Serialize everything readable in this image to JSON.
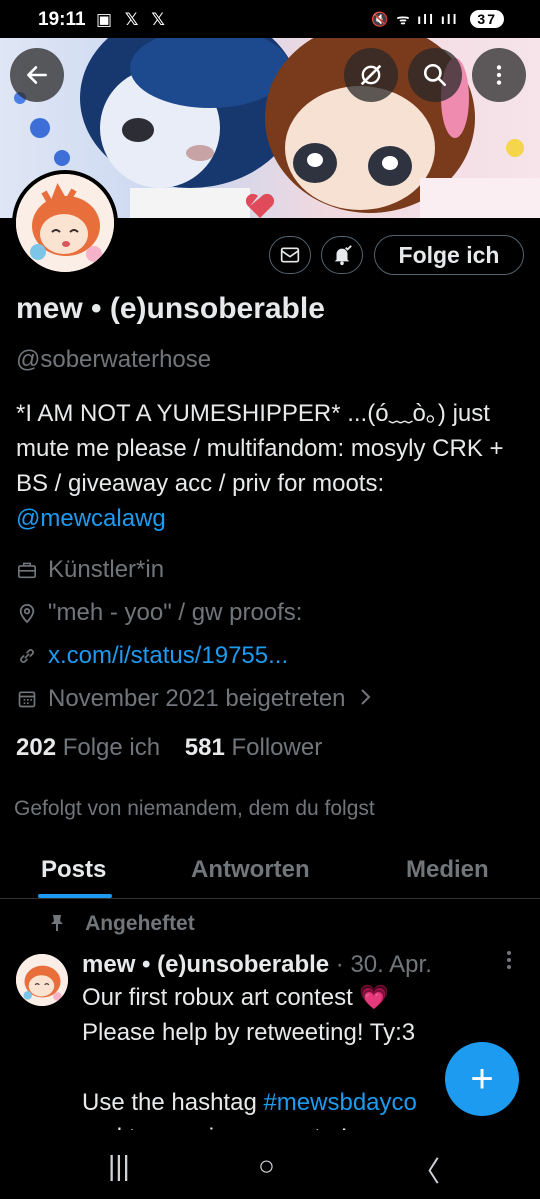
{
  "status_bar": {
    "time": "19:11",
    "left_icons": "▣ 𝕏 𝕏",
    "right_icons": "🔇 ᯤ ıll ıll",
    "battery": "37"
  },
  "header": {
    "back_icon": "arrow-left-icon",
    "mute_icon": "mute-icon",
    "search_icon": "search-icon",
    "more_icon": "more-vertical-icon"
  },
  "actions": {
    "message_icon": "mail-icon",
    "notify_icon": "bell-check-icon",
    "follow_label": "Folge ich"
  },
  "profile": {
    "name": "mew • (e)unsoberable",
    "handle": "@soberwaterhose",
    "bio_text": "*I AM NOT A YUMESHIPPER* ...(ó﹏ò｡) just mute me please / multifandom: mosyly CRK + BS  / giveaway acc / priv for moots: ",
    "bio_link": "@mewcalawg",
    "profession": "Künstler*in",
    "location": "\"meh - yoo\" / gw proofs:",
    "website": "x.com/i/status/19755...",
    "joined": "November 2021 beigetreten",
    "following_count": "202",
    "following_label": "Folge ich",
    "followers_count": "581",
    "followers_label": "Follower",
    "followed_by": "Gefolgt von niemandem, dem du folgst"
  },
  "tabs": [
    "Posts",
    "Antworten",
    "Medien"
  ],
  "post": {
    "pinned_label": "Angeheftet",
    "author": "mew • (e)unsoberable",
    "date": "· 30. Apr.",
    "line1": "Our first robux art contest 💗",
    "line2": "Please help by retweeting! Ty:3",
    "line3": "Use the hashtag ",
    "hashtag": "#mewsbdayco",
    "line4": "and tag me in your entry!"
  },
  "fab_label": "+",
  "nav": {
    "recents": "|||",
    "home": "○",
    "back": "〈"
  }
}
